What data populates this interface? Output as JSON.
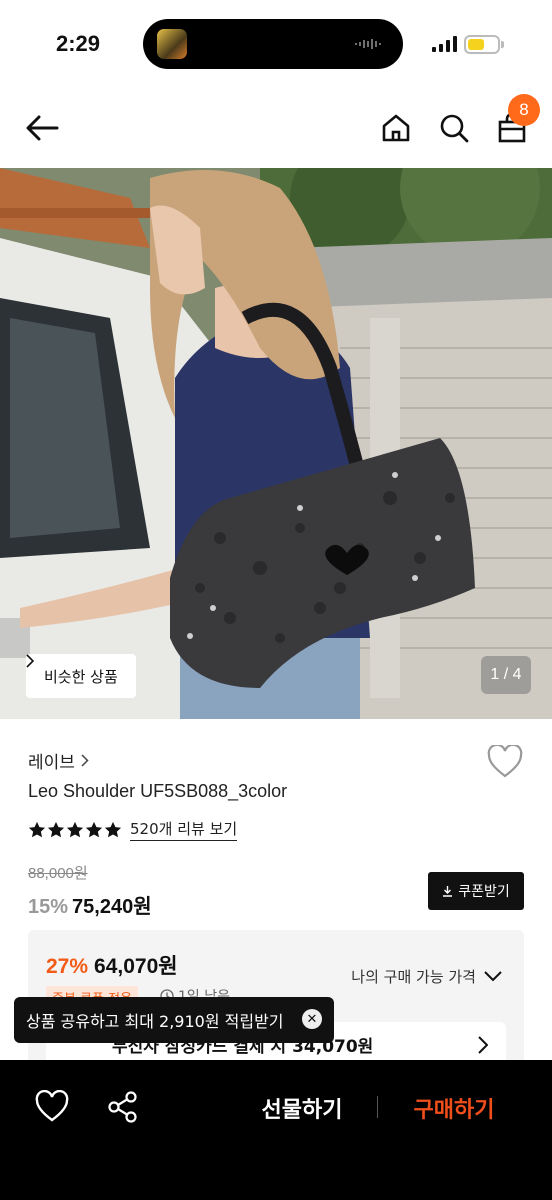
{
  "status_bar": {
    "time": "2:29"
  },
  "header": {
    "cart_count": "8"
  },
  "hero": {
    "similar_label": "비슷한 상품",
    "page_indicator": "1 / 4"
  },
  "product": {
    "brand": "레이브",
    "name": "Leo Shoulder UF5SB088_3color",
    "rating": 5,
    "review_link": "520개 리뷰 보기",
    "original_price": "88,000원",
    "discount": "15%",
    "price": "75,240원",
    "coupon_button": "쿠폰받기"
  },
  "best_price": {
    "discount": "27%",
    "price": "64,070원",
    "my_price_label": "나의 구매 가능 가격",
    "dup_coupon_badge": "중복 쿠폰 적용",
    "days_left": "1일 남음",
    "card_offer": "무신사 삼성카드 결제 시 34,070원"
  },
  "toast": {
    "text": "상품 공유하고 최대 2,910원 적립받기"
  },
  "bottom_bar": {
    "gift_label": "선물하기",
    "buy_label": "구매하기"
  },
  "colors": {
    "accent": "#f25c19",
    "badge": "#ff6a1a",
    "bar": "#000000"
  }
}
